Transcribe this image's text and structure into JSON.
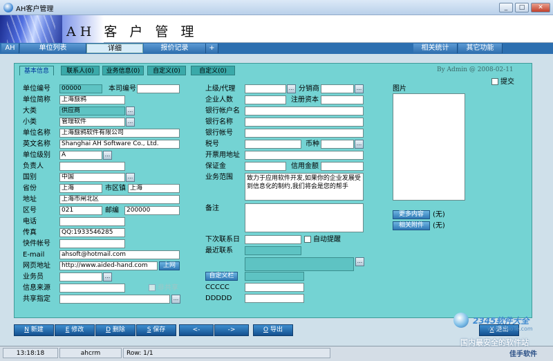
{
  "window": {
    "title": "AH客户管理",
    "buttons": {
      "minimize": "_",
      "maximize": "□",
      "close": "✕"
    }
  },
  "banner": {
    "product_name": "AH 客 户 管 理"
  },
  "nav": {
    "tabs": [
      "AH",
      "单位列表",
      "详细",
      "报价记录",
      "+"
    ],
    "right_tabs": [
      "相关统计",
      "其它功能"
    ]
  },
  "subtabs": [
    "基本信息",
    "联系人(0)",
    "业务信息(0)",
    "自定义(0)",
    "自定义(0)"
  ],
  "byline": "By Admin @ 2008-02-11",
  "left_form": {
    "unit_no": {
      "label": "单位编号",
      "value": "00000"
    },
    "own_no": {
      "label": "本司编号",
      "value": ""
    },
    "short_name": {
      "label": "单位简称",
      "value": "上海鼗鸦"
    },
    "category": {
      "label": "大类",
      "value": "供应商"
    },
    "subcategory": {
      "label": "小类",
      "value": "管理软件"
    },
    "unit_name": {
      "label": "单位名称",
      "value": "上海鼗鸦软件有限公司"
    },
    "english_name": {
      "label": "英文名称",
      "value": "Shanghai AH Software Co., Ltd."
    },
    "level": {
      "label": "单位级别",
      "value": "A"
    },
    "manager": {
      "label": "负责人",
      "value": ""
    },
    "country": {
      "label": "国别",
      "value": "中国"
    },
    "province": {
      "label": "省份",
      "value": "上海"
    },
    "city": {
      "label": "市区镇",
      "value": "上海"
    },
    "address": {
      "label": "地址",
      "value": "上海市闸北区"
    },
    "area_code": {
      "label": "区号",
      "value": "021"
    },
    "zip": {
      "label": "邮编",
      "value": "200000"
    },
    "phone": {
      "label": "电话",
      "value": ""
    },
    "fax": {
      "label": "传真",
      "value": "QQ:1933546285"
    },
    "courier": {
      "label": "快件帐号",
      "value": ""
    },
    "email": {
      "label": "E-mail",
      "value": "ahsoft@hotmail.com"
    },
    "website": {
      "label": "网页地址",
      "value": "http://www.aided-hand.com",
      "button": "上网"
    },
    "salesman": {
      "label": "业务员",
      "value": ""
    },
    "source": {
      "label": "信息来源",
      "value": "",
      "checkbox_label": "非共享"
    },
    "share": {
      "label": "共享指定",
      "value": ""
    }
  },
  "mid_form": {
    "parent": {
      "label": "上级/代理",
      "value": ""
    },
    "dealer": {
      "label": "分销商",
      "value": ""
    },
    "headcount": {
      "label": "企业人数",
      "value": ""
    },
    "capital": {
      "label": "注册资本",
      "value": ""
    },
    "bank_account_name": {
      "label": "银行帐户名",
      "value": ""
    },
    "bank_name": {
      "label": "银行名称",
      "value": ""
    },
    "bank_account": {
      "label": "银行帐号",
      "value": ""
    },
    "tax_no": {
      "label": "税号",
      "value": ""
    },
    "currency": {
      "label": "币种",
      "value": ""
    },
    "invoice_address": {
      "label": "开票用地址",
      "value": ""
    },
    "deposit": {
      "label": "保证金",
      "value": ""
    },
    "credit": {
      "label": "信用金额",
      "value": ""
    },
    "business_scope": {
      "label": "业务范围",
      "value": "致力于应用软件开发,如果你的企业发展受到信息化的制约,我们将会是您的帮手"
    },
    "remarks": {
      "label": "备注",
      "value": ""
    },
    "next_contact": {
      "label": "下次联系日",
      "value": "",
      "checkbox_label": "自动提醒"
    },
    "last_contact": {
      "label": "最近联系",
      "value": ""
    },
    "custom_button": "自定义栏",
    "ccccc": {
      "label": "CCCCC",
      "value": ""
    },
    "ddddd": {
      "label": "DDDDD",
      "value": ""
    }
  },
  "right_panel": {
    "picture_label": "图片",
    "submit_label": "提交",
    "more_content_button": "更多内容",
    "more_content_value": "(无)",
    "attachment_button": "相关附件",
    "attachment_value": "(无)"
  },
  "bottom_buttons": [
    {
      "key": "N",
      "label": "新建"
    },
    {
      "key": "E",
      "label": "修改"
    },
    {
      "key": "D",
      "label": "删除"
    },
    {
      "key": "S",
      "label": "保存"
    },
    {
      "key": "",
      "label": "<-"
    },
    {
      "key": "",
      "label": "->"
    },
    {
      "key": "O",
      "label": "导出"
    },
    {
      "key": "X",
      "label": "退出"
    }
  ],
  "status": {
    "time": "13:18:18",
    "user": "ahcrm",
    "row": "Row: 1/1"
  },
  "watermark": {
    "line1": "2345软件大全",
    "line2": "www.DuoTe.com",
    "line3": "国内最安全的软件站",
    "line4": "佳手软件"
  }
}
